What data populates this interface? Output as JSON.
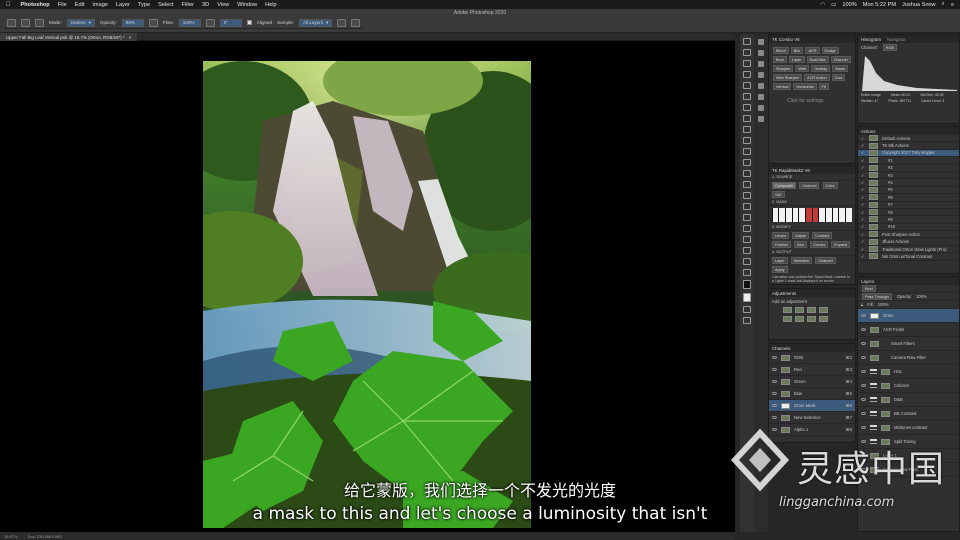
{
  "menubar": {
    "app": "Photoshop",
    "items": [
      "File",
      "Edit",
      "Image",
      "Layer",
      "Type",
      "Select",
      "Filter",
      "3D",
      "View",
      "Window",
      "Help"
    ],
    "battery": "100%",
    "clock": "Mon 5:22 PM",
    "user": "Joshua Snow"
  },
  "window_title": "Adobe Photoshop 2020",
  "options": {
    "mode_label": "Mode:",
    "mode_value": "Darken",
    "opacity_label": "Opacity:",
    "opacity_value": "86%",
    "flow_label": "Flow:",
    "flow_value": "100%",
    "angle_value": "0°",
    "aligned_label": "Aligned",
    "sample_label": "Sample:",
    "sample_value": "All Layers"
  },
  "document": {
    "tab": "Upper Fall Big Leaf Vertical.psb @ 16.7% (Orton, RGB/16*) *",
    "zoom": "16.67%",
    "doc_info": "Doc: 230.1M/3.09G"
  },
  "subtitles": {
    "zh": "给它蒙版，我们选择一个不发光的光度",
    "en": "a mask to this and let's choose a luminosity that isn't"
  },
  "combo_panel": {
    "title": "TK Combo V6",
    "buttons": [
      "Blend",
      "Blur",
      "ACR",
      "Dodge",
      "Burn",
      "Layer",
      "Dual Mas",
      "Channel",
      "Sharpen",
      "Web",
      "Overlay",
      "Warm"
    ],
    "extra": [
      "Web Sharpen",
      "ACR Action",
      "Cool",
      "Vertical",
      "Horizontal",
      "Fit"
    ],
    "settings_label": "Click for settings"
  },
  "rapidmask_panel": {
    "title": "TK RapidMask2 V6",
    "source_label": "1. SOURCE",
    "source_tabs": [
      "Composite",
      "Channel",
      "Color",
      "SAT"
    ],
    "mask_label": "2. MASK",
    "modify_label": "3. MODIFY",
    "modify_buttons": [
      "Levels",
      "Adjust",
      "Contract",
      "Feather",
      "Blur",
      "Curves",
      "Expand"
    ],
    "output_label": "4. OUTPUT",
    "output_buttons": [
      "Layer",
      "Selection",
      "Channel",
      "Apply"
    ],
    "hint": "Calculates and updates the 'Rapid Mask' channel to a Lights 1 mask and displays it on screen."
  },
  "histogram": {
    "tabs": [
      "Histogram",
      "Navigator"
    ],
    "channel_label": "Channel:",
    "channel_value": "RGB",
    "source_value": "Entire Image",
    "stats": [
      "Mean: 60.20",
      "Std Dev: 49.25",
      "Median: 47",
      "Pixels: 987711",
      "Level:",
      "Count:",
      "Percentile:",
      "Cache Level: 4"
    ]
  },
  "actions": {
    "title": "Actions",
    "items": [
      "Default Actions",
      "TK Mk Actions",
      "Copyright 2017 Tony Kuyper",
      "#1",
      "#2",
      "#3",
      "#4",
      "#5",
      "#6",
      "#7",
      "#8",
      "#9",
      "#10",
      "Post Sharpen Action",
      "Jfluxer Actions",
      "Traditional Orton Glow Lights (Pro)",
      "Nik Orton w/Tonal Contrast"
    ]
  },
  "adjustments": {
    "title": "Adjustments",
    "subtitle": "Add an adjustment"
  },
  "channels": {
    "title": "Channels",
    "items": [
      {
        "name": "RGB",
        "key": "⌘2"
      },
      {
        "name": "Red",
        "key": "⌘3"
      },
      {
        "name": "Green",
        "key": "⌘4"
      },
      {
        "name": "Blue",
        "key": "⌘5"
      },
      {
        "name": "Orton Mask",
        "key": "⌘6"
      },
      {
        "name": "New Selection",
        "key": "⌘7"
      },
      {
        "name": "Alpha 1",
        "key": "⌘8"
      }
    ]
  },
  "layers": {
    "title": "Layers",
    "kind": "Kind",
    "blend": "Pass Through",
    "opacity_label": "Opacity:",
    "opacity_value": "100%",
    "fill_label": "Fill:",
    "fill_value": "100%",
    "items": [
      {
        "name": "Orton",
        "sel": true
      },
      {
        "name": "ACR Finish"
      },
      {
        "name": "Smart Filters"
      },
      {
        "name": "Camera Raw Filter"
      },
      {
        "name": "HSL"
      },
      {
        "name": "Colorize"
      },
      {
        "name": "D&B"
      },
      {
        "name": "BB Contrast"
      },
      {
        "name": "Midtones contrast"
      },
      {
        "name": "Split Toning"
      },
      {
        "name": "Layer 1"
      },
      {
        "name": "Camera Raw Filter"
      }
    ]
  },
  "watermark": {
    "cn": "灵感中国",
    "url": "lingganchina.com"
  }
}
